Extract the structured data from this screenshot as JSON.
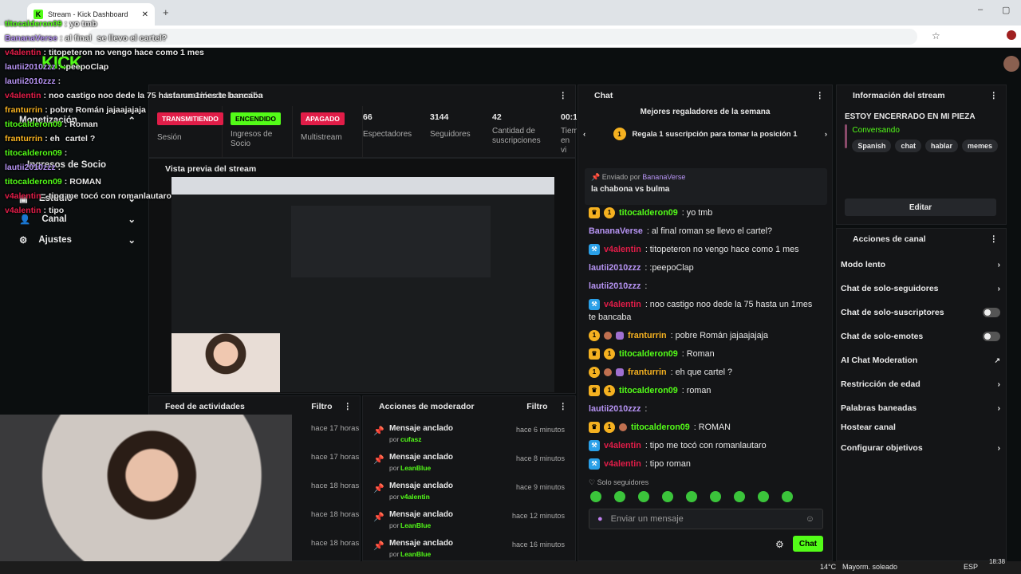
{
  "browser": {
    "tab_title": "Stream - Kick Dashboard",
    "favicon": "K"
  },
  "sidebar": {
    "items": [
      {
        "label": "Monetización"
      },
      {
        "label": "Ingresos de Socio"
      },
      {
        "label": "Estudio"
      },
      {
        "label": "Canal"
      },
      {
        "label": "Ajustes"
      }
    ]
  },
  "session": {
    "title": "Información de la sesión",
    "stats": [
      {
        "value": "TRANSMITIENDO",
        "label": "Sesión",
        "badge_color": "#e11d48"
      },
      {
        "value": "ENCENDIDO",
        "label": "Ingresos de Socio",
        "badge_color": "#53fc18"
      },
      {
        "value": "APAGADO",
        "label": "Multistream",
        "badge_color": "#e11d48"
      },
      {
        "value": "66",
        "label": "Espectadores"
      },
      {
        "value": "3144",
        "label": "Seguidores"
      },
      {
        "value": "42",
        "label": "Cantidad de suscripciones"
      },
      {
        "value": "00:1",
        "label": "Tiem en vi"
      }
    ]
  },
  "preview": {
    "title": "Vista previa del stream"
  },
  "feed": {
    "title": "Feed de actividades",
    "filter": "Filtro",
    "times": [
      "hace 17 horas",
      "hace 17 horas",
      "hace 18 horas",
      "hace 18 horas",
      "hace 18 horas"
    ]
  },
  "mod": {
    "title": "Acciones de moderador",
    "filter": "Filtro",
    "rows": [
      {
        "action": "Mensaje anclado",
        "by": "por",
        "user": "cufasz",
        "time": "hace 6 minutos"
      },
      {
        "action": "Mensaje anclado",
        "by": "por",
        "user": "LeanBlue",
        "time": "hace 8 minutos"
      },
      {
        "action": "Mensaje anclado",
        "by": "por",
        "user": "v4alentin",
        "time": "hace 9 minutos"
      },
      {
        "action": "Mensaje anclado",
        "by": "por",
        "user": "LeanBlue",
        "time": "hace 12 minutos"
      },
      {
        "action": "Mensaje anclado",
        "by": "por",
        "user": "LeanBlue",
        "time": "hace 16 minutos"
      }
    ]
  },
  "chat": {
    "title": "Chat",
    "gifters_title": "Mejores regaladores de la semana",
    "gift_rank": "1",
    "gift_text": "Regala 1 suscripción para tomar la posición 1",
    "pinned": {
      "sent_by": "Enviado por",
      "user": "BananaVerse",
      "text": "la chabona vs bulma"
    },
    "messages": [
      {
        "user": "titocalderon09",
        "color": "#53fc18",
        "text": ": yo tmb",
        "badges": "crown,one"
      },
      {
        "user": "BananaVerse",
        "color": "#b794f4",
        "text": ": al final roman se llevo el cartel?",
        "badges": ""
      },
      {
        "user": "v4alentin",
        "color": "#e11d48",
        "text": ": titopeteron no vengo hace como 1 mes",
        "badges": "hamm"
      },
      {
        "user": "lautii2010zzz",
        "color": "#b794f4",
        "text": ": :peepoClap",
        "badges": ""
      },
      {
        "user": "lautii2010zzz",
        "color": "#b794f4",
        "text": ":",
        "badges": ""
      },
      {
        "user": "v4alentin",
        "color": "#e11d48",
        "text": ": noo castigo noo dede la 75 hasta un 1mes",
        "badges": "hamm"
      },
      {
        "user": "",
        "color": "#e8e8e8",
        "text": "te bancaba",
        "badges": ""
      },
      {
        "user": "franturrin",
        "color": "#f5b120",
        "text": ": pobre Román jajaajajaja",
        "badges": "one,vod,gift"
      },
      {
        "user": "titocalderon09",
        "color": "#53fc18",
        "text": ": Roman",
        "badges": "crown,one"
      },
      {
        "user": "franturrin",
        "color": "#f5b120",
        "text": ": eh que cartel ?",
        "badges": "one,vod,gift"
      },
      {
        "user": "titocalderon09",
        "color": "#53fc18",
        "text": ": roman",
        "badges": "crown,one"
      },
      {
        "user": "lautii2010zzz",
        "color": "#b794f4",
        "text": ":",
        "badges": ""
      },
      {
        "user": "titocalderon09",
        "color": "#53fc18",
        "text": ": ROMAN",
        "badges": "crown,one,vod"
      },
      {
        "user": "v4alentin",
        "color": "#e11d48",
        "text": ": tipo me tocó con romanlautaro",
        "badges": "hamm"
      },
      {
        "user": "v4alentin",
        "color": "#e11d48",
        "text": ": tipo roman",
        "badges": "hamm"
      }
    ],
    "mode_label": "Solo seguidores",
    "input_placeholder": "Enviar un mensaje",
    "send_label": "Chat"
  },
  "stream_info": {
    "title": "Información del stream",
    "stream_title": "ESTOY ENCERRADO EN MI PIEZA",
    "category": "Conversando",
    "tags": [
      "Spanish",
      "chat",
      "hablar",
      "memes"
    ],
    "edit_label": "Editar"
  },
  "channel_actions": {
    "title": "Acciones de canal",
    "items": [
      {
        "label": "Modo lento",
        "control": "chevron"
      },
      {
        "label": "Chat de solo-seguidores",
        "control": "chevron"
      },
      {
        "label": "Chat de solo-suscriptores",
        "control": "toggle"
      },
      {
        "label": "Chat de solo-emotes",
        "control": "toggle"
      },
      {
        "label": "AI Chat Moderation",
        "control": "external"
      },
      {
        "label": "Restricción de edad",
        "control": "chevron"
      },
      {
        "label": "Palabras baneadas",
        "control": "chevron"
      },
      {
        "label": "Hostear canal",
        "control": "none"
      },
      {
        "label": "Configurar objetivos",
        "control": "chevron"
      }
    ]
  },
  "overlay": {
    "lines": [
      {
        "user": "titocalderon09",
        "color": "#53fc18",
        "text": ": yo tmb"
      },
      {
        "user": "BananaVerse",
        "color": "#b794f4",
        "text": ": al final",
        "text2": "se llevo el cartel?"
      },
      {
        "user": "v4alentin",
        "color": "#e11d48",
        "text": ": titopeteron no vengo hace como 1 mes"
      },
      {
        "user": "lautii2010zzz",
        "color": "#b794f4",
        "text": ": :peepoClap"
      },
      {
        "user": "lautii2010zzz",
        "color": "#b794f4",
        "text": ":"
      },
      {
        "user": "v4alentin",
        "color": "#e11d48",
        "text": ": noo castigo noo dede la 75 hasta un 1mes te bancaba"
      },
      {
        "user": "franturrin",
        "color": "#f5b120",
        "text": ": pobre Román jajaajajaja"
      },
      {
        "user": "titocalderon09",
        "color": "#53fc18",
        "text": ": Roman"
      },
      {
        "user": "franturrin",
        "color": "#f5b120",
        "text": ": eh",
        "text2": "cartel ?"
      },
      {
        "user": "titocalderon09",
        "color": "#53fc18",
        "text": ":"
      },
      {
        "user": "lautii2010zzz",
        "color": "#b794f4",
        "text": ":"
      },
      {
        "user": "titocalderon09",
        "color": "#53fc18",
        "text": ": ROMAN"
      },
      {
        "user": "v4alentin",
        "color": "#e11d48",
        "text": ": tipo me tocó con romanlautaro"
      },
      {
        "user": "v4alentin",
        "color": "#e11d48",
        "text": ": tipo"
      }
    ]
  },
  "taskbar": {
    "weather": "14°C",
    "weather_desc": "Mayorm. soleado",
    "lang": "ESP",
    "clock": "18:38"
  }
}
